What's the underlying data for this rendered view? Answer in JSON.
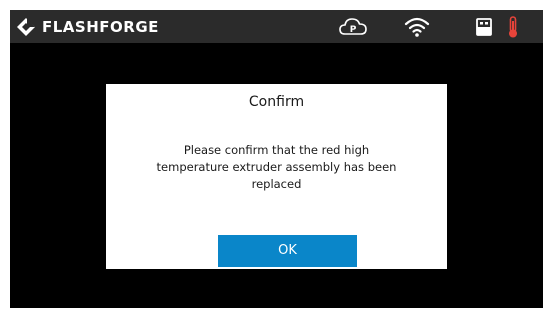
{
  "status_bar": {
    "brand": "FLASHFORGE",
    "icons": [
      "flashforge-logo-icon",
      "cloud-p-icon",
      "wifi-icon",
      "usb-icon",
      "thermometer-icon"
    ],
    "colors": {
      "background": "#2b2b2b",
      "thermometer": "#e8443a"
    }
  },
  "dialog": {
    "title": "Confirm",
    "message": "Please confirm that the red high temperature extruder assembly has been replaced",
    "ok_label": "OK",
    "colors": {
      "button": "#0a86c9"
    }
  }
}
